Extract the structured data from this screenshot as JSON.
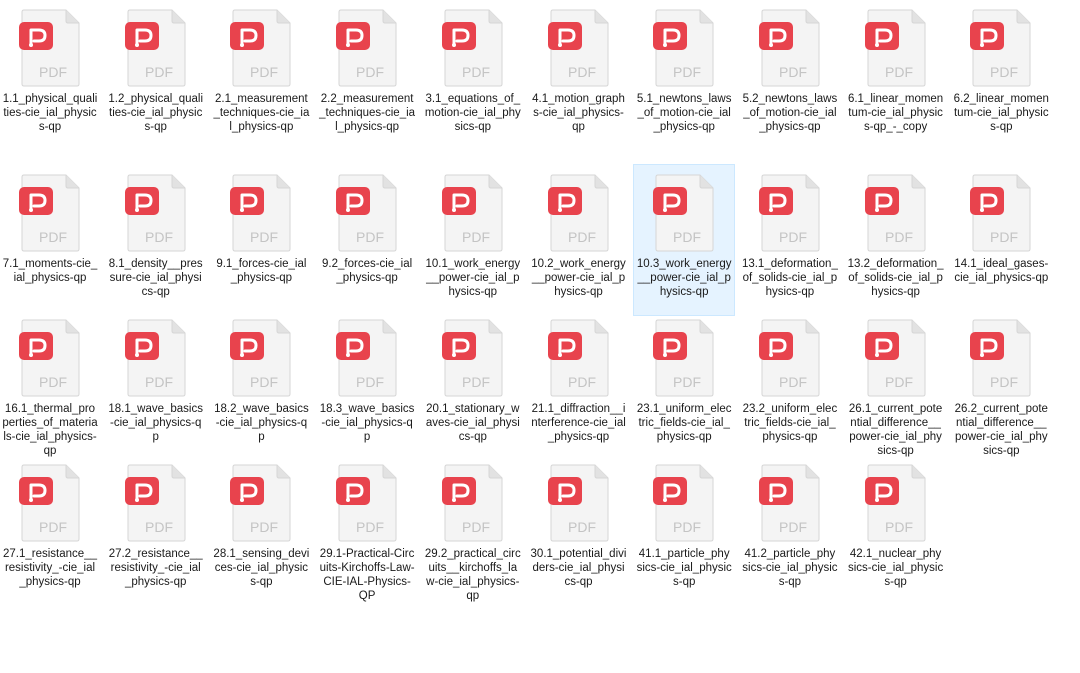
{
  "icon": {
    "name": "pdf-file-icon",
    "badge_text": "PDF",
    "accent": "#e8434d",
    "page_color": "#f4f4f4"
  },
  "selected_index": 16,
  "files": [
    "1.1_physical_qualities-cie_ial_physics-qp",
    "1.2_physical_qualities-cie_ial_physics-qp",
    "2.1_measurement_techniques-cie_ial_physics-qp",
    "2.2_measurement_techniques-cie_ial_physics-qp",
    "3.1_equations_of_motion-cie_ial_physics-qp",
    "4.1_motion_graphs-cie_ial_physics-qp",
    "5.1_newtons_laws_of_motion-cie_ial_physics-qp",
    "5.2_newtons_laws_of_motion-cie_ial_physics-qp",
    "6.1_linear_momentum-cie_ial_physics-qp_-_copy",
    "6.2_linear_momentum-cie_ial_physics-qp",
    "7.1_moments-cie_ial_physics-qp",
    "8.1_density__pressure-cie_ial_physics-qp",
    "9.1_forces-cie_ial_physics-qp",
    "9.2_forces-cie_ial_physics-qp",
    "10.1_work_energy__power-cie_ial_physics-qp",
    "10.2_work_energy__power-cie_ial_physics-qp",
    "10.3_work_energy__power-cie_ial_physics-qp",
    "13.1_deformation_of_solids-cie_ial_physics-qp",
    "13.2_deformation_of_solids-cie_ial_physics-qp",
    "14.1_ideal_gases-cie_ial_physics-qp",
    "16.1_thermal_properties_of_materials-cie_ial_physics-qp",
    "18.1_wave_basics-cie_ial_physics-qp",
    "18.2_wave_basics-cie_ial_physics-qp",
    "18.3_wave_basics-cie_ial_physics-qp",
    "20.1_stationary_waves-cie_ial_physics-qp",
    "21.1_diffraction__interference-cie_ial_physics-qp",
    "23.1_uniform_electric_fields-cie_ial_physics-qp",
    "23.2_uniform_electric_fields-cie_ial_physics-qp",
    "26.1_current_potential_difference__power-cie_ial_physics-qp",
    "26.2_current_potential_difference__power-cie_ial_physics-qp",
    "27.1_resistance__resistivity_-cie_ial_physics-qp",
    "27.2_resistance__resistivity_-cie_ial_physics-qp",
    "28.1_sensing_devices-cie_ial_physics-qp",
    "29.1-Practical-Circuits-Kirchoffs-Law-CIE-IAL-Physics-QP",
    "29.2_practical_circuits__kirchoffs_law-cie_ial_physics-qp",
    "30.1_potential_dividers-cie_ial_physics-qp",
    "41.1_particle_physics-cie_ial_physics-qp",
    "41.2_particle_physics-cie_ial_physics-qp",
    "42.1_nuclear_physics-cie_ial_physics-qp"
  ]
}
